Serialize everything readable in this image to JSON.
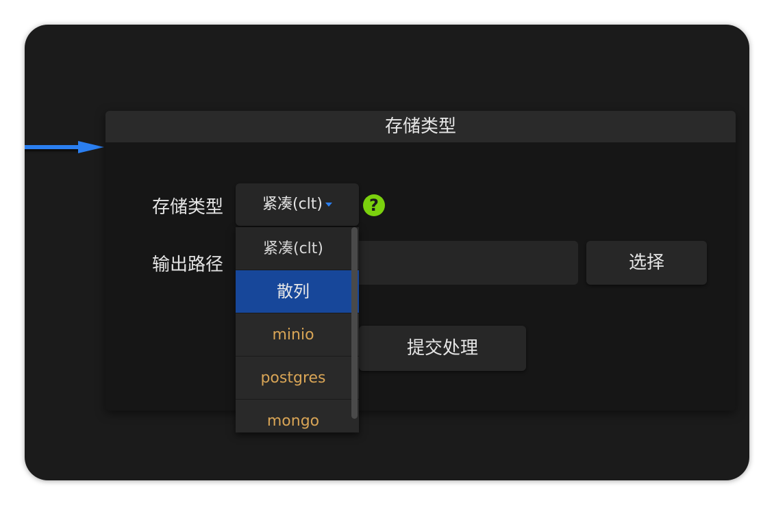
{
  "panel": {
    "title": "存储类型"
  },
  "form": {
    "storage_label": "存储类型",
    "storage_value": "紧凑(clt)",
    "help_glyph": "?",
    "output_label": "输出路径",
    "output_placeholder": "输出路径",
    "choose_button": "选择",
    "submit_button": "提交处理"
  },
  "dropdown": {
    "options": [
      "紧凑(clt)",
      "散列",
      "minio",
      "postgres",
      "mongo"
    ],
    "selected": "散列"
  },
  "colors": {
    "accent": "#2b7ff0",
    "selected_bg": "#17479a",
    "plugin_text": "#d9a556",
    "help_icon": "#7bd10e"
  }
}
